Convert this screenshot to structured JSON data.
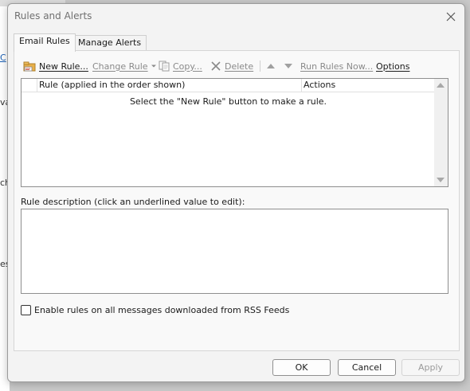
{
  "background": {
    "fragments": [
      {
        "text": "C",
        "link": true
      },
      {
        "text": "va",
        "link": false
      },
      {
        "text": "ch",
        "link": false
      },
      {
        "text": "es,",
        "link": false
      }
    ]
  },
  "dialog": {
    "title": "Rules and Alerts",
    "tabs": [
      {
        "label": "Email Rules",
        "active": true
      },
      {
        "label": "Manage Alerts",
        "active": false
      }
    ],
    "toolbar": {
      "new_rule": "New Rule...",
      "change_rule": "Change Rule",
      "copy": "Copy...",
      "delete": "Delete",
      "run_rules_now": "Run Rules Now...",
      "options": "Options"
    },
    "rules_list": {
      "columns": [
        "Rule (applied in the order shown)",
        "Actions"
      ],
      "empty_message": "Select the \"New Rule\" button to make a rule."
    },
    "description_label": "Rule description (click an underlined value to edit):",
    "rss_checkbox": {
      "label": "Enable rules on all messages downloaded from RSS Feeds",
      "checked": false
    },
    "buttons": {
      "ok": "OK",
      "cancel": "Cancel",
      "apply": "Apply"
    }
  },
  "icons": {
    "close": "close-icon",
    "new_rule": "new-rule-icon",
    "copy": "copy-icon",
    "delete": "delete-icon",
    "move_up": "move-up-icon",
    "move_down": "move-down-icon"
  },
  "colors": {
    "dialog_bg": "#f3f3f3",
    "panel_bg": "#f9f9f9",
    "disabled_text": "#8a8a8a",
    "link": "#1a5fb4"
  }
}
